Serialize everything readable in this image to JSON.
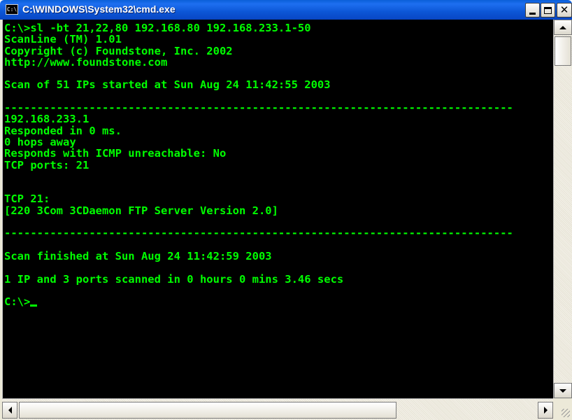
{
  "window": {
    "title": "C:\\WINDOWS\\System32\\cmd.exe",
    "icon_label": "C:\\",
    "controls": {
      "minimize": "minimize",
      "maximize": "maximize",
      "close": "✕"
    }
  },
  "colors": {
    "console_bg": "#000000",
    "console_text": "#00ff00",
    "titlebar": "#0c56d6"
  },
  "console": {
    "lines": [
      "C:\\>sl -bt 21,22,80 192.168.80 192.168.233.1-50",
      "ScanLine (TM) 1.01",
      "Copyright (c) Foundstone, Inc. 2002",
      "http://www.foundstone.com",
      "",
      "Scan of 51 IPs started at Sun Aug 24 11:42:55 2003",
      "",
      "------------------------------------------------------------------------------",
      "192.168.233.1",
      "Responded in 0 ms.",
      "0 hops away",
      "Responds with ICMP unreachable: No",
      "TCP ports: 21",
      "",
      "",
      "TCP 21:",
      "[220 3Com 3CDaemon FTP Server Version 2.0]",
      "",
      "------------------------------------------------------------------------------",
      "",
      "Scan finished at Sun Aug 24 11:42:59 2003",
      "",
      "1 IP and 3 ports scanned in 0 hours 0 mins 3.46 secs",
      ""
    ],
    "prompt": "C:\\>"
  }
}
